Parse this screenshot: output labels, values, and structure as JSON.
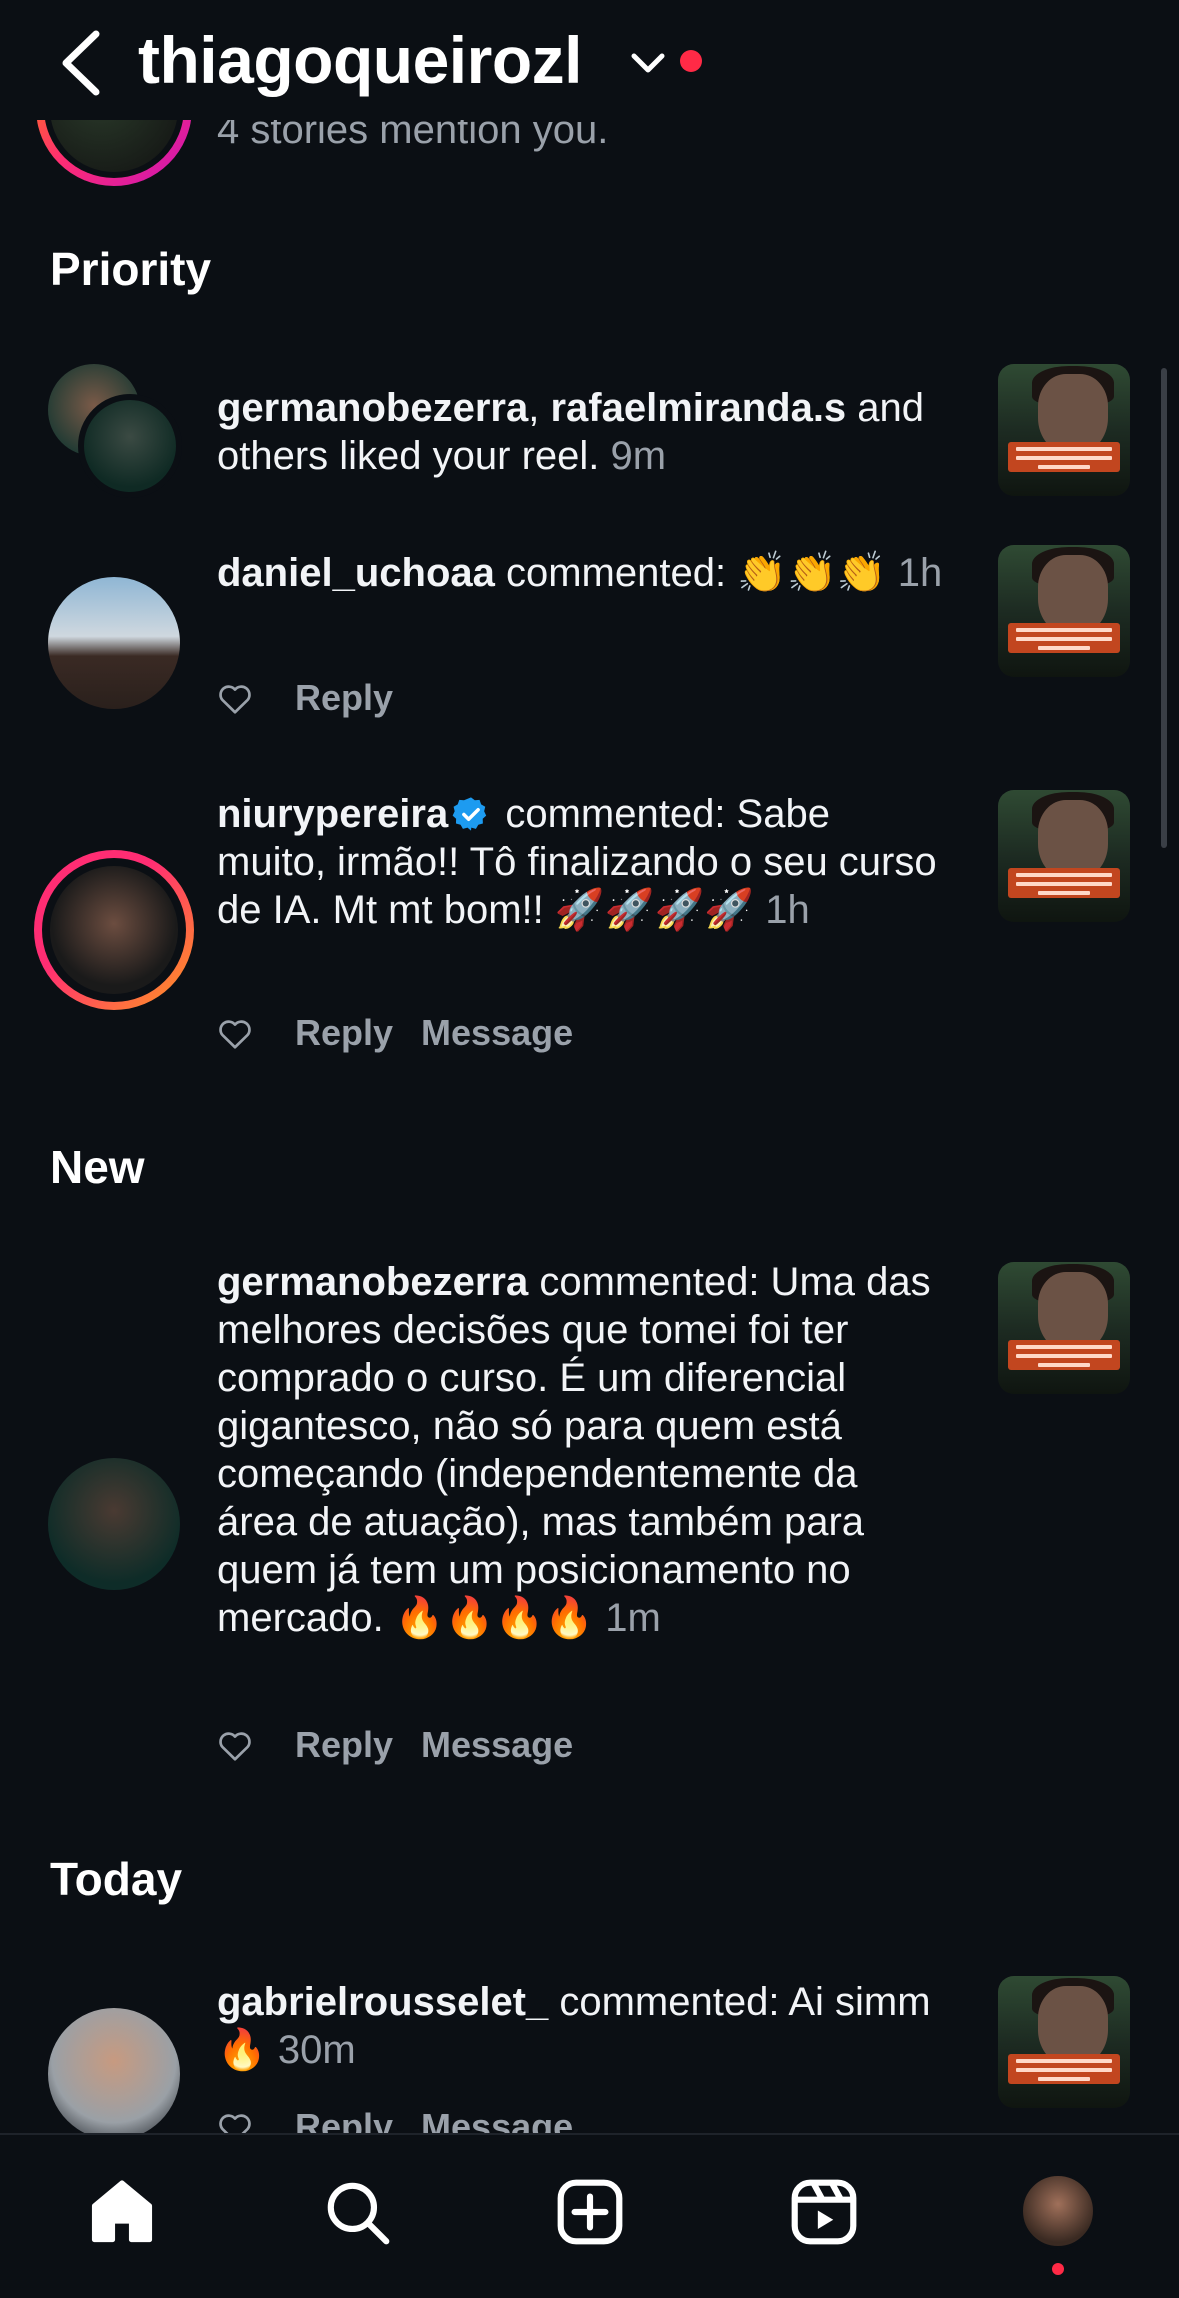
{
  "header": {
    "title": "thiagoqueirozl"
  },
  "stories": {
    "text": "4 stories mention you."
  },
  "sections": {
    "priority": "Priority",
    "new": "New",
    "today": "Today"
  },
  "items": [
    {
      "user": "germanobezerra",
      "sep": ", ",
      "user2": "rafaelmiranda.s",
      "text": " and others liked your reel.",
      "time": " 9m"
    },
    {
      "user": "daniel_uchoaa",
      "text": " commented: 👏👏👏",
      "time": " 1h",
      "reply": "Reply"
    },
    {
      "user": "niurypereira",
      "text": " commented: Sabe muito, irmão!! Tô finalizando o seu curso de IA. Mt mt bom!! 🚀🚀🚀🚀",
      "time": " 1h",
      "reply": "Reply",
      "message": "Message"
    },
    {
      "user": "germanobezerra",
      "text": " commented: Uma das melhores decisões que tomei foi ter comprado o curso. É um diferencial gigantesco, não só para quem está começando (independentemente da área de atuação), mas também para quem já tem um posicionamento no mercado. 🔥🔥🔥🔥",
      "time": " 1m",
      "reply": "Reply",
      "message": "Message"
    },
    {
      "user": "gabrielrousselet_",
      "text": " commented: Ai simm 🔥",
      "time": " 30m",
      "reply": "Reply",
      "message": "Message"
    }
  ],
  "thumbnail_caption": "COMO CRIEI AGENTES DE IA QUE VENDEM NO AUTOMÁTICO TODOS OS DIAS",
  "icons": {
    "back": "back-arrow-icon",
    "chevron": "chevron-down-icon",
    "home": "home-icon",
    "search": "search-icon",
    "create": "create-icon",
    "reels": "reels-icon",
    "profile": "profile-avatar",
    "heart": "heart-icon",
    "verified": "verified-badge-icon"
  },
  "colors": {
    "accent_red": "#ff2a46",
    "verified_blue": "#1d9bf0",
    "background": "#0b0f14"
  }
}
